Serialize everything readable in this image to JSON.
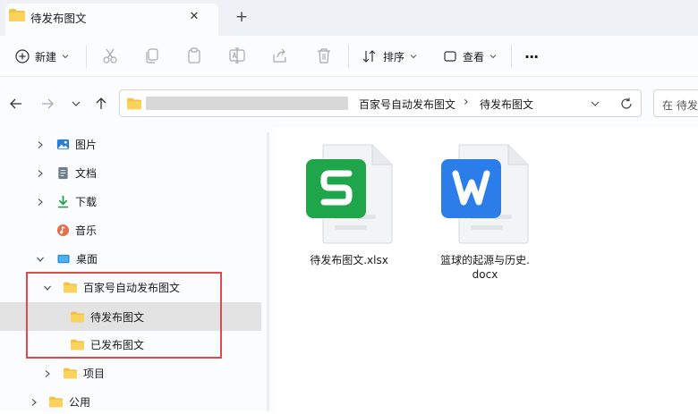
{
  "tab": {
    "title": "待发布图文",
    "close": "✕",
    "new_tab": "+"
  },
  "command_bar": {
    "new_label": "新建",
    "sort_label": "排序",
    "view_label": "查看",
    "more": "···"
  },
  "address": {
    "crumbs": [
      "百家号自动发布图文",
      "待发布图文"
    ],
    "separator": "›",
    "search_placeholder": "在 待发"
  },
  "tree": {
    "items": [
      {
        "label": "图片",
        "icon": "pictures-icon"
      },
      {
        "label": "文档",
        "icon": "documents-icon"
      },
      {
        "label": "下载",
        "icon": "downloads-icon"
      },
      {
        "label": "音乐",
        "icon": "music-icon"
      },
      {
        "label": "桌面",
        "icon": "desktop-icon"
      },
      {
        "label": "百家号自动发布图文",
        "icon": "folder-icon"
      },
      {
        "label": "待发布图文",
        "icon": "folder-icon"
      },
      {
        "label": "已发布图文",
        "icon": "folder-icon"
      },
      {
        "label": "项目",
        "icon": "folder-icon"
      },
      {
        "label": "公用",
        "icon": "folder-icon"
      }
    ]
  },
  "files": [
    {
      "name": "待发布图文.xlsx",
      "icon": "wps-spreadsheet-icon",
      "accent": "#1fa64a"
    },
    {
      "name_line1": "篮球的起源与历史.",
      "name_line2": "docx",
      "icon": "wps-writer-icon",
      "accent": "#2b7de9"
    }
  ],
  "colors": {
    "folder": "#f5c343",
    "selection": "#e3e3e3",
    "highlight_box": "#e54848"
  }
}
